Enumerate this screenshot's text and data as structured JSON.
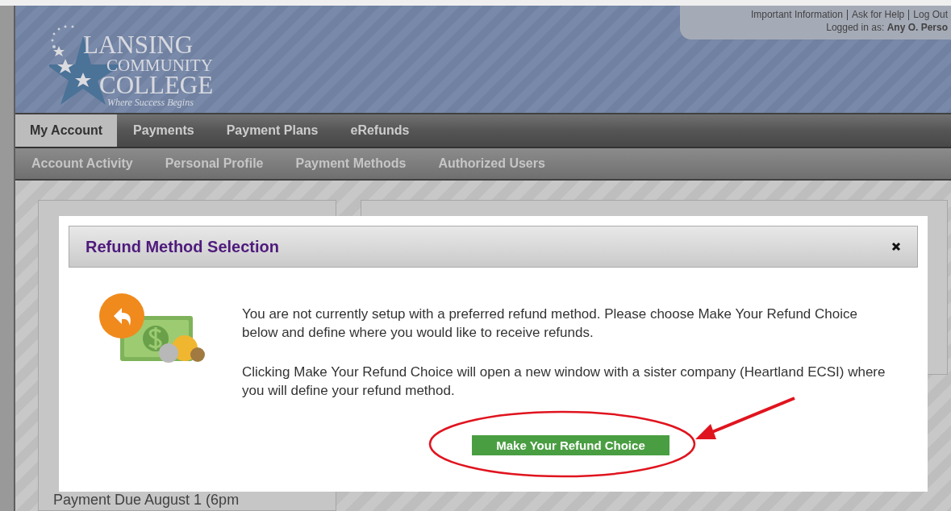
{
  "header": {
    "logo": {
      "line_1": "LANSING",
      "line_2": "COMMUNITY",
      "line_3": "COLLEGE",
      "tagline": "Where Success Begins"
    },
    "top_links": [
      "Important Information",
      "Ask for Help",
      "Log Out"
    ],
    "login": "Logged in as: **Any O. Perso**"
  },
  "tabs": [
    {
      "label": "My Account",
      "selected": true
    },
    {
      "label": "Payments",
      "selected": false
    },
    {
      "label": "Payment Plans",
      "selected": false
    },
    {
      "label": "eRefunds",
      "selected": false
    }
  ],
  "subtabs": [
    "Account Activity",
    "Personal Profile",
    "Payment Methods",
    "Authorized Users"
  ],
  "background": {
    "left_panel": {
      "footer": "Payment Due August 1 (6pm"
    }
  },
  "modal": {
    "title": "Refund Method Selection",
    "paragraphs": [
      "You are not currently setup with a preferred refund method. Please choose Make Your Refund Choice below and define where you would like to receive refunds.",
      "Clicking Make Your Refund Choice will open a new window with a sister company (Heartland ECSI) where you will define your refund method."
    ],
    "button": "Make Your Refund Choice"
  }
}
